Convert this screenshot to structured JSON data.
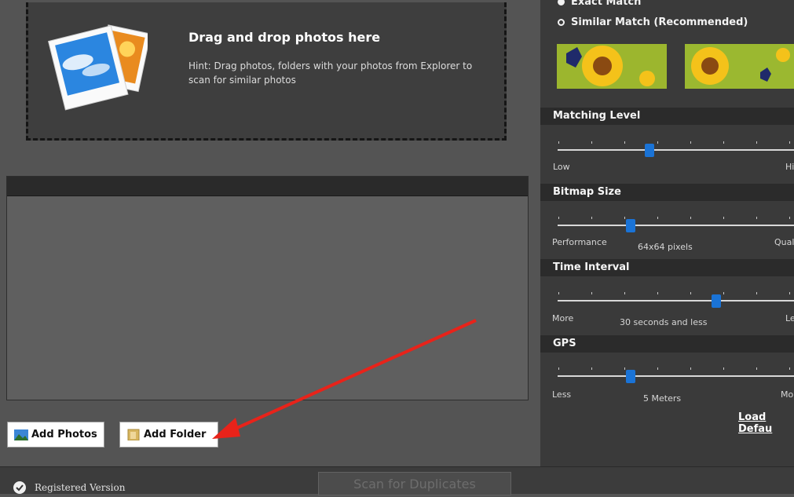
{
  "dropzone": {
    "title": "Drag and drop photos here",
    "hint": "Hint: Drag photos, folders with your photos from Explorer to scan for similar photos"
  },
  "buttons": {
    "add_photos": "Add Photos",
    "add_folder": "Add Folder"
  },
  "match_mode": {
    "exact": "Exact Match",
    "similar": "Similar Match (Recommended)",
    "selected": "exact"
  },
  "sections": {
    "matching_level": {
      "title": "Matching Level",
      "left": "Low",
      "right": "Hi",
      "value_fraction": 0.39
    },
    "bitmap_size": {
      "title": "Bitmap Size",
      "left": "Performance",
      "center": "64x64 pixels",
      "right": "Qual",
      "value_fraction": 0.31
    },
    "time_interval": {
      "title": "Time Interval",
      "left": "More",
      "center": "30 seconds and less",
      "right": "Le",
      "value_fraction": 0.67
    },
    "gps": {
      "title": "GPS",
      "left": "Less",
      "center": "5 Meters",
      "right": "Mo",
      "value_fraction": 0.31
    }
  },
  "load_defaults": "Load Defau",
  "footer": {
    "registered": "Registered Version",
    "scan": "Scan for Duplicates"
  },
  "colors": {
    "accent": "#1a73d6",
    "annotation_arrow": "#e8231a"
  }
}
